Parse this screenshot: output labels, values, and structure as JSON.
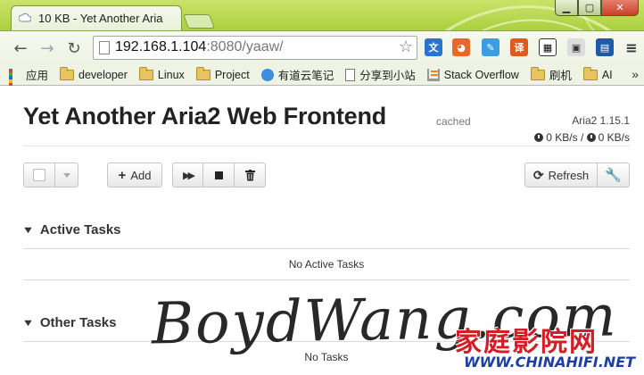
{
  "browser": {
    "tab_title": "10 KB - Yet Another Aria",
    "url_host": "192.168.1.104",
    "url_rest": ":8080/yaaw/",
    "bookmarks": [
      {
        "label": "应用",
        "icon": "apps-icon"
      },
      {
        "label": "developer",
        "icon": "folder-icon"
      },
      {
        "label": "Linux",
        "icon": "folder-icon"
      },
      {
        "label": "Project",
        "icon": "folder-icon"
      },
      {
        "label": "有道云笔记",
        "icon": "youdao-icon"
      },
      {
        "label": "分享到小站",
        "icon": "page-icon"
      },
      {
        "label": "Stack Overflow",
        "icon": "stackoverflow-icon"
      },
      {
        "label": "刷机",
        "icon": "folder-icon"
      },
      {
        "label": "AI",
        "icon": "folder-icon"
      }
    ],
    "more_bookmarks": "»",
    "colors": {
      "frame": "#a9cf3c",
      "close": "#c7402b"
    }
  },
  "app": {
    "title": "Yet Another Aria2 Web Frontend",
    "cached_label": "cached",
    "version": "Aria2 1.15.1",
    "download_speed": "0 KB/s",
    "speed_separator": "/",
    "upload_speed": "0 KB/s"
  },
  "toolbar": {
    "add_label": "Add",
    "refresh_label": "Refresh"
  },
  "sections": {
    "active": {
      "title": "Active Tasks",
      "empty": "No Active Tasks"
    },
    "other": {
      "title": "Other Tasks",
      "empty": "No Tasks"
    }
  },
  "watermarks": {
    "handwritten": "BoydWang.com",
    "logo": "家庭影院网",
    "logo_url": "WWW.CHINAHIFI.NET"
  }
}
